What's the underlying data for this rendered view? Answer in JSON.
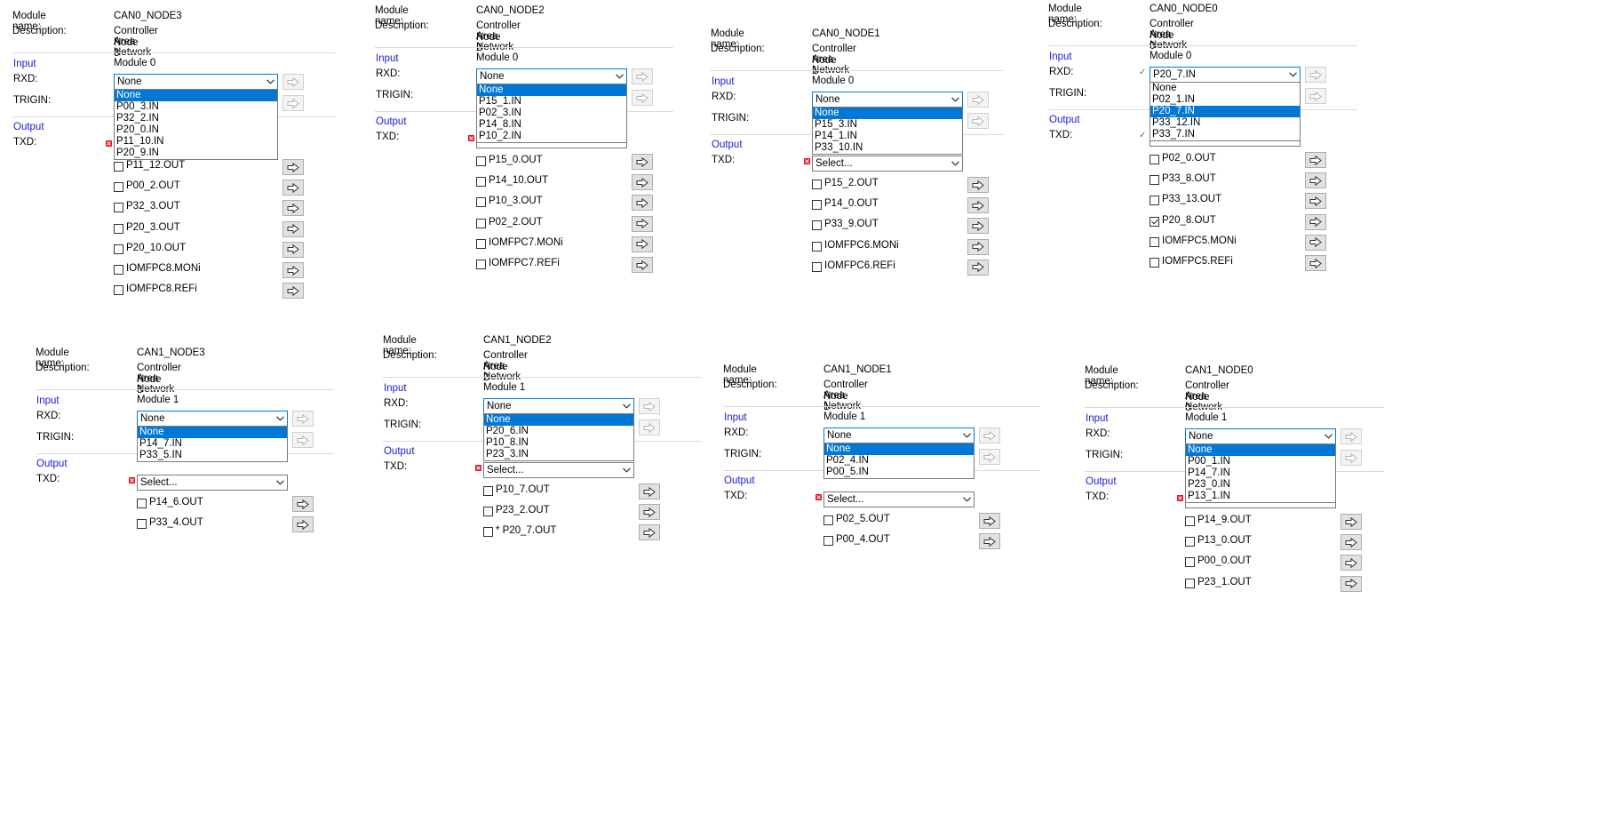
{
  "common": {
    "module_name_label": "Module name:",
    "description_label": "Description:",
    "input_label": "Input",
    "rxd_label": "RXD:",
    "trigin_label": "TRIGIN:",
    "output_label": "Output",
    "txd_label": "TXD:",
    "select_placeholder": "Select..."
  },
  "panels": [
    {
      "id": "can0_node3",
      "module_name": "CAN0_NODE3",
      "description_1": "Controller Area Network Module 0",
      "description_2": "Node 3",
      "rxd_value": "None",
      "rxd_options": [
        "None",
        "P00_3.IN",
        "P32_2.IN",
        "P20_0.IN",
        "P11_10.IN",
        "P20_9.IN"
      ],
      "rxd_selected": 0,
      "txd_status": "error",
      "txd_value": "",
      "txd_options": [
        {
          "label": "P11_12.OUT",
          "checked": false
        },
        {
          "label": "P00_2.OUT",
          "checked": false
        },
        {
          "label": "P32_3.OUT",
          "checked": false
        },
        {
          "label": "P20_3.OUT",
          "checked": false
        },
        {
          "label": "P20_10.OUT",
          "checked": false
        },
        {
          "label": "IOMFPC8.MONi",
          "checked": false
        },
        {
          "label": "IOMFPC8.REFi",
          "checked": false
        }
      ]
    },
    {
      "id": "can0_node2",
      "module_name": "CAN0_NODE2",
      "description_1": "Controller Area Network Module 0",
      "description_2": "Node 2",
      "rxd_value": "None",
      "rxd_options": [
        "None",
        "P15_1.IN",
        "P02_3.IN",
        "P14_8.IN",
        "P10_2.IN"
      ],
      "rxd_selected": 0,
      "txd_status": "error",
      "txd_value": "",
      "txd_options": [
        {
          "label": "P15_0.OUT",
          "checked": false
        },
        {
          "label": "P14_10.OUT",
          "checked": false
        },
        {
          "label": "P10_3.OUT",
          "checked": false
        },
        {
          "label": "P02_2.OUT",
          "checked": false
        },
        {
          "label": "IOMFPC7.MONi",
          "checked": false
        },
        {
          "label": "IOMFPC7.REFi",
          "checked": false
        }
      ]
    },
    {
      "id": "can0_node1",
      "module_name": "CAN0_NODE1",
      "description_1": "Controller Area Network Module 0",
      "description_2": "Node 1",
      "rxd_value": "None",
      "rxd_options": [
        "None",
        "P15_3.IN",
        "P14_1.IN",
        "P33_10.IN"
      ],
      "rxd_selected": 0,
      "txd_status": "error",
      "txd_value": "Select...",
      "txd_options": [
        {
          "label": "P15_2.OUT",
          "checked": false
        },
        {
          "label": "P14_0.OUT",
          "checked": false
        },
        {
          "label": "P33_9.OUT",
          "checked": false
        },
        {
          "label": "IOMFPC6.MONi",
          "checked": false
        },
        {
          "label": "IOMFPC6.REFi",
          "checked": false
        }
      ]
    },
    {
      "id": "can0_node0",
      "module_name": "CAN0_NODE0",
      "description_1": "Controller Area Network Module 0",
      "description_2": "Node 0",
      "rxd_value": "P20_7.IN",
      "rxd_options": [
        "None",
        "P02_1.IN",
        "P20_7.IN",
        "P33_12.IN",
        "P33_7.IN"
      ],
      "rxd_selected": 2,
      "rxd_status": "ok",
      "txd_status": "ok",
      "txd_value": "",
      "txd_options": [
        {
          "label": "P02_0.OUT",
          "checked": false
        },
        {
          "label": "P33_8.OUT",
          "checked": false
        },
        {
          "label": "P33_13.OUT",
          "checked": false
        },
        {
          "label": "P20_8.OUT",
          "checked": true
        },
        {
          "label": "IOMFPC5.MONi",
          "checked": false
        },
        {
          "label": "IOMFPC5.REFi",
          "checked": false
        }
      ]
    },
    {
      "id": "can1_node3",
      "module_name": "CAN1_NODE3",
      "description_1": "Controller Area Network Module 1",
      "description_2": "Node 3",
      "rxd_value": "None",
      "rxd_options": [
        "None",
        "P14_7.IN",
        "P33_5.IN"
      ],
      "rxd_selected": 0,
      "txd_status": "error",
      "txd_value": "Select...",
      "txd_options": [
        {
          "label": "P14_6.OUT",
          "checked": false
        },
        {
          "label": "P33_4.OUT",
          "checked": false
        }
      ]
    },
    {
      "id": "can1_node2",
      "module_name": "CAN1_NODE2",
      "description_1": "Controller Area Network Module 1",
      "description_2": "Node 2",
      "rxd_value": "None",
      "rxd_options": [
        "None",
        "P20_6.IN",
        "P10_8.IN",
        "P23_3.IN"
      ],
      "rxd_selected": 0,
      "txd_status": "error",
      "txd_value": "Select...",
      "txd_options": [
        {
          "label": "P10_7.OUT",
          "checked": false
        },
        {
          "label": "P23_2.OUT",
          "checked": false
        },
        {
          "label": "* P20_7.OUT",
          "checked": false
        }
      ]
    },
    {
      "id": "can1_node1",
      "module_name": "CAN1_NODE1",
      "description_1": "Controller Area Network Module 1",
      "description_2": "Node 1",
      "rxd_value": "None",
      "rxd_options": [
        "None",
        "P02_4.IN",
        "P00_5.IN"
      ],
      "rxd_selected": 0,
      "txd_status": "error",
      "txd_value": "Select...",
      "txd_options": [
        {
          "label": "P02_5.OUT",
          "checked": false
        },
        {
          "label": "P00_4.OUT",
          "checked": false
        }
      ]
    },
    {
      "id": "can1_node0",
      "module_name": "CAN1_NODE0",
      "description_1": "Controller Area Network Module 1",
      "description_2": "Node 0",
      "rxd_value": "None",
      "rxd_options": [
        "None",
        "P00_1.IN",
        "P14_7.IN",
        "P23_0.IN",
        "P13_1.IN"
      ],
      "rxd_selected": 0,
      "txd_status": "error",
      "txd_value": "",
      "txd_options": [
        {
          "label": "P14_9.OUT",
          "checked": false
        },
        {
          "label": "P13_0.OUT",
          "checked": false
        },
        {
          "label": "P00_0.OUT",
          "checked": false
        },
        {
          "label": "P23_1.OUT",
          "checked": false
        }
      ]
    }
  ]
}
